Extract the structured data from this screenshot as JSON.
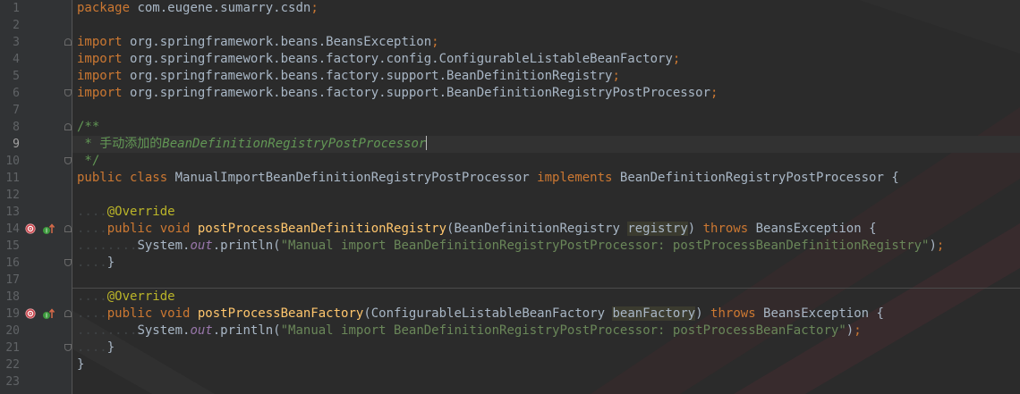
{
  "editor": {
    "current_line": "9",
    "lines": [
      {
        "num": "1",
        "fold": "",
        "marker": false,
        "tokens": [
          [
            "kw",
            "package"
          ],
          [
            "txt",
            " com.eugene.sumarry.csdn"
          ],
          [
            "kw",
            ";"
          ]
        ]
      },
      {
        "num": "2",
        "fold": "",
        "marker": false,
        "tokens": []
      },
      {
        "num": "3",
        "fold": "opener",
        "marker": false,
        "tokens": [
          [
            "kw",
            "import"
          ],
          [
            "txt",
            " org.springframework.beans.BeansException"
          ],
          [
            "kw",
            ";"
          ]
        ]
      },
      {
        "num": "4",
        "fold": "",
        "marker": false,
        "tokens": [
          [
            "kw",
            "import"
          ],
          [
            "txt",
            " org.springframework.beans.factory.config.ConfigurableListableBeanFactory"
          ],
          [
            "kw",
            ";"
          ]
        ]
      },
      {
        "num": "5",
        "fold": "",
        "marker": false,
        "tokens": [
          [
            "kw",
            "import"
          ],
          [
            "txt",
            " org.springframework.beans.factory.support.BeanDefinitionRegistry"
          ],
          [
            "kw",
            ";"
          ]
        ]
      },
      {
        "num": "6",
        "fold": "closer",
        "marker": false,
        "tokens": [
          [
            "kw",
            "import"
          ],
          [
            "txt",
            " org.springframework.beans.factory.support.BeanDefinitionRegistryPostProcessor"
          ],
          [
            "kw",
            ";"
          ]
        ]
      },
      {
        "num": "7",
        "fold": "",
        "marker": false,
        "tokens": []
      },
      {
        "num": "8",
        "fold": "opener",
        "marker": false,
        "tokens": [
          [
            "doc",
            "/**"
          ]
        ]
      },
      {
        "num": "9",
        "fold": "",
        "marker": false,
        "tokens": [
          [
            "doc",
            " * 手动添加的"
          ],
          [
            "doc-i",
            "BeanDefinitionRegistryPostProcessor"
          ],
          [
            "caret",
            ""
          ]
        ]
      },
      {
        "num": "10",
        "fold": "closer",
        "marker": false,
        "tokens": [
          [
            "doc",
            " */"
          ]
        ]
      },
      {
        "num": "11",
        "fold": "",
        "marker": false,
        "tokens": [
          [
            "kw",
            "public class"
          ],
          [
            "txt",
            " ManualImportBeanDefinitionRegistryPostProcessor "
          ],
          [
            "kw",
            "implements"
          ],
          [
            "txt",
            " BeanDefinitionRegistryPostProcessor {"
          ]
        ]
      },
      {
        "num": "12",
        "fold": "",
        "marker": false,
        "tokens": []
      },
      {
        "num": "13",
        "fold": "",
        "marker": false,
        "tokens": [
          [
            "dots",
            "...."
          ],
          [
            "ann",
            "@Override"
          ]
        ]
      },
      {
        "num": "14",
        "fold": "opener",
        "marker": true,
        "tokens": [
          [
            "dots",
            "...."
          ],
          [
            "kw",
            "public void "
          ],
          [
            "fn",
            "postProcessBeanDefinitionRegistry"
          ],
          [
            "txt",
            "(BeanDefinitionRegistry "
          ],
          [
            "par",
            "registry"
          ],
          [
            "txt",
            ") "
          ],
          [
            "kw",
            "throws"
          ],
          [
            "txt",
            " BeansException {"
          ]
        ]
      },
      {
        "num": "15",
        "fold": "",
        "marker": false,
        "tokens": [
          [
            "dots",
            "........"
          ],
          [
            "txt",
            "System."
          ],
          [
            "fld",
            "out"
          ],
          [
            "txt",
            ".println("
          ],
          [
            "str",
            "\"Manual import BeanDefinitionRegistryPostProcessor: postProcessBeanDefinitionRegistry\""
          ],
          [
            "txt",
            ")"
          ],
          [
            "kw",
            ";"
          ]
        ]
      },
      {
        "num": "16",
        "fold": "closer",
        "marker": false,
        "tokens": [
          [
            "dots",
            "...."
          ],
          [
            "txt",
            "}"
          ]
        ]
      },
      {
        "num": "17",
        "fold": "",
        "marker": false,
        "tokens": []
      },
      {
        "num": "18",
        "fold": "",
        "marker": false,
        "tokens": [
          [
            "dots",
            "...."
          ],
          [
            "ann",
            "@Override"
          ]
        ]
      },
      {
        "num": "19",
        "fold": "opener",
        "marker": true,
        "tokens": [
          [
            "dots",
            "...."
          ],
          [
            "kw",
            "public void "
          ],
          [
            "fn",
            "postProcessBeanFactory"
          ],
          [
            "txt",
            "(ConfigurableListableBeanFactory "
          ],
          [
            "par",
            "beanFactory"
          ],
          [
            "txt",
            ") "
          ],
          [
            "kw",
            "throws"
          ],
          [
            "txt",
            " BeansException {"
          ]
        ]
      },
      {
        "num": "20",
        "fold": "",
        "marker": false,
        "tokens": [
          [
            "dots",
            "........"
          ],
          [
            "txt",
            "System."
          ],
          [
            "fld",
            "out"
          ],
          [
            "txt",
            ".println("
          ],
          [
            "str",
            "\"Manual import BeanDefinitionRegistryPostProcessor: postProcessBeanFactory\""
          ],
          [
            "txt",
            ")"
          ],
          [
            "kw",
            ";"
          ]
        ]
      },
      {
        "num": "21",
        "fold": "closer",
        "marker": false,
        "tokens": [
          [
            "dots",
            "...."
          ],
          [
            "txt",
            "}"
          ]
        ]
      },
      {
        "num": "22",
        "fold": "",
        "marker": false,
        "tokens": [
          [
            "txt",
            "}"
          ]
        ]
      },
      {
        "num": "23",
        "fold": "",
        "marker": false,
        "tokens": []
      }
    ]
  },
  "colors": {
    "background": "#2b2b2b",
    "gutter": "#313335",
    "keyword": "#cc7832",
    "text": "#a9b7c6",
    "annotation": "#bbb529",
    "method": "#ffc66d",
    "string": "#6a8759",
    "doc_comment": "#629755",
    "static_field": "#9876aa",
    "line_number": "#606366"
  },
  "icons": {
    "bean_marker": "spring-bean-icon",
    "override_marker": "implements-method-icon",
    "fold": "code-fold-icon"
  }
}
